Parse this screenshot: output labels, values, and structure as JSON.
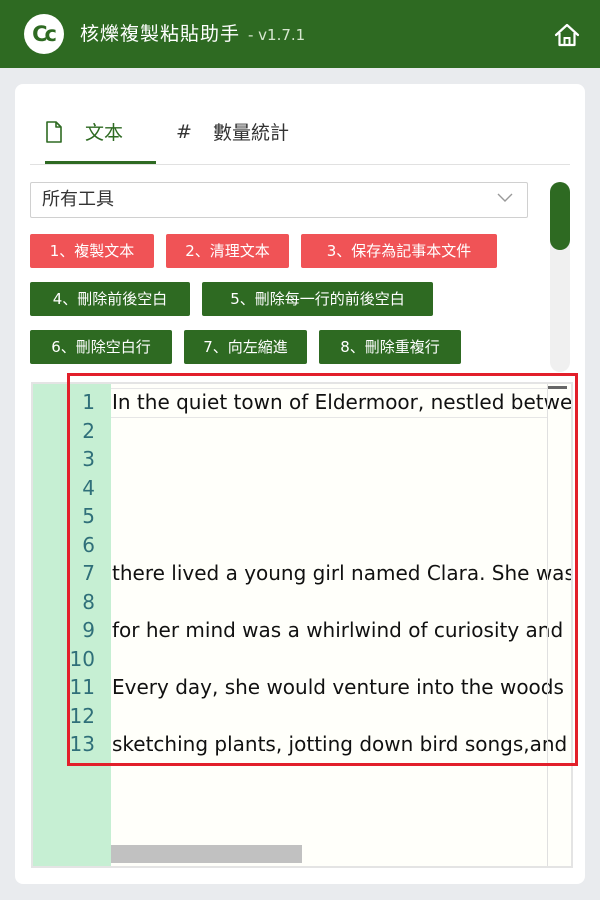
{
  "app": {
    "title": "核爍複製粘貼助手",
    "version": "- v1.7.1",
    "logo_text": "Cc",
    "home_icon": "home-icon"
  },
  "tabs": [
    {
      "label": "文本",
      "icon": "document-icon",
      "active": true
    },
    {
      "label": "數量統計",
      "icon": "hash-icon",
      "active": false
    }
  ],
  "tool_select": {
    "value": "所有工具"
  },
  "buttons": [
    {
      "label": "1、複製文本",
      "color": "#f05356"
    },
    {
      "label": "2、清理文本",
      "color": "#f05356"
    },
    {
      "label": "3、保存為記事本文件",
      "color": "#f05356"
    },
    {
      "label": "4、刪除前後空白",
      "color": "#2e6a22"
    },
    {
      "label": "5、刪除每一行的前後空白",
      "color": "#2e6a22"
    },
    {
      "label": "6、刪除空白行",
      "color": "#2e6a22"
    },
    {
      "label": "7、向左縮進",
      "color": "#2e6a22"
    },
    {
      "label": "8、刪除重複行",
      "color": "#2e6a22"
    }
  ],
  "editor": {
    "line_numbers": [
      "1",
      "2",
      "3",
      "4",
      "5",
      "6",
      "7",
      "8",
      "9",
      "10",
      "11",
      "12",
      "13"
    ],
    "lines": [
      "In the quiet town of Eldermoor, nestled betwe",
      "",
      "",
      "",
      "",
      "",
      "there lived a young girl named Clara. She was",
      "",
      "for her mind was a whirlwind of curiosity and",
      "",
      "Every day, she would venture into the woods w",
      "",
      "sketching plants, jotting down bird songs,and"
    ]
  },
  "colors": {
    "brand_green": "#2e6a22",
    "accent_red": "#f05356",
    "gutter": "#c6efd3",
    "highlight": "#e21f2a"
  }
}
